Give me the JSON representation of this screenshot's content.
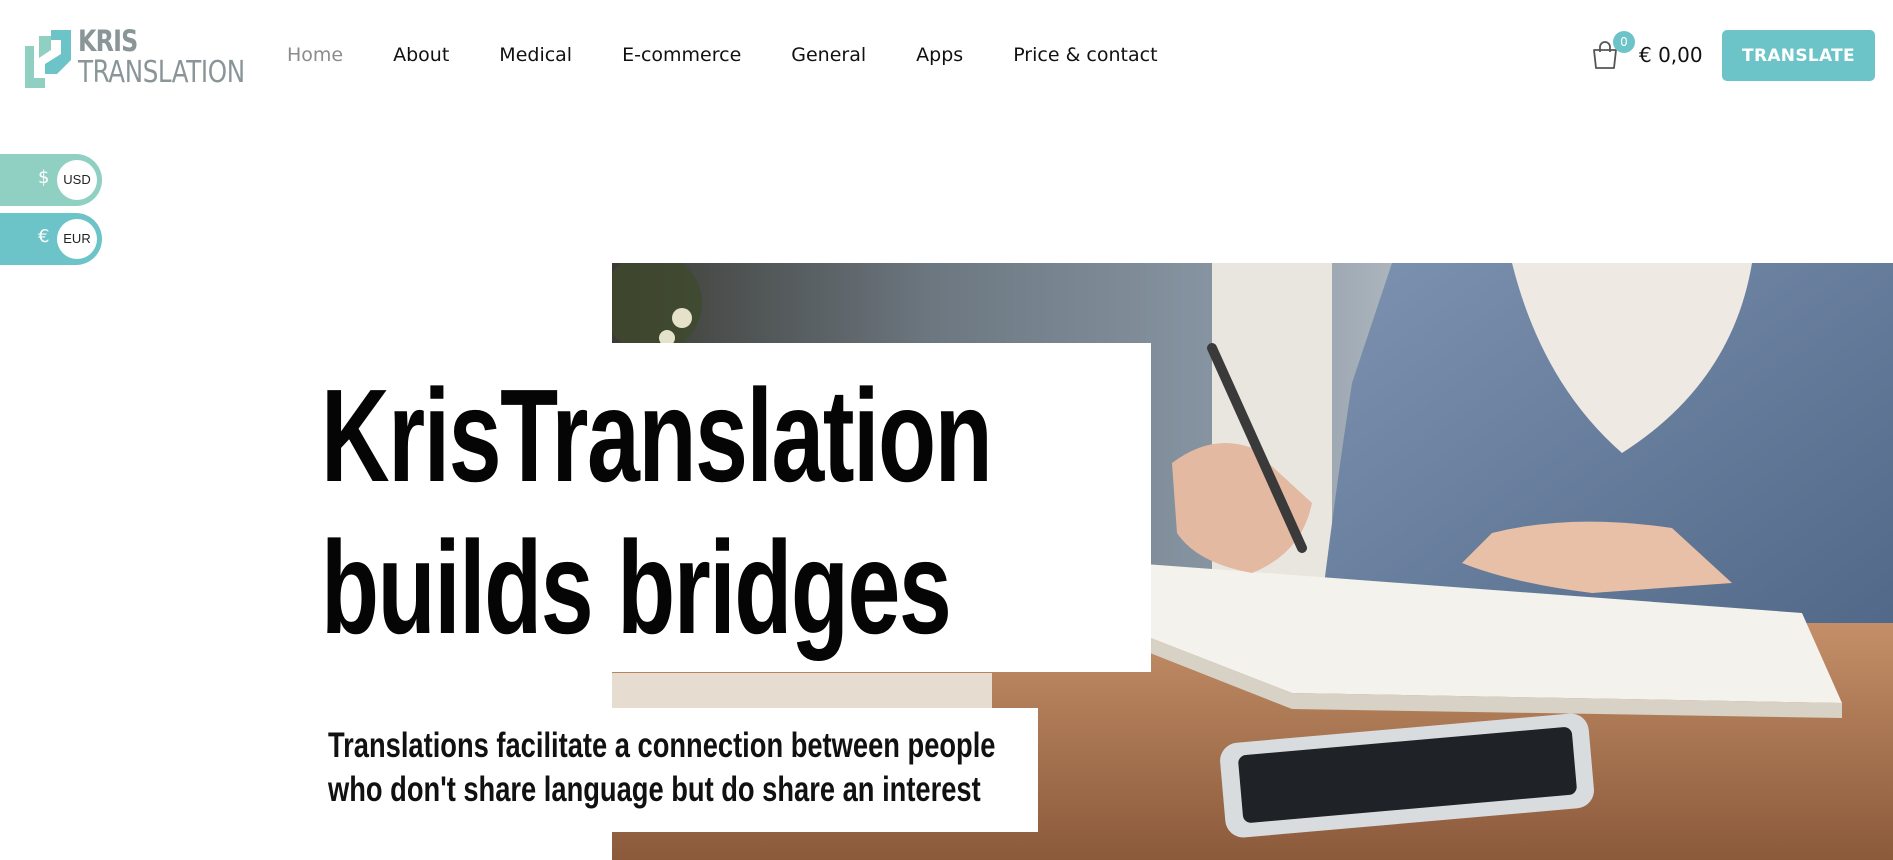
{
  "header": {
    "logo": {
      "line1": "KRIS",
      "line2": "TRANSLATION"
    },
    "nav": [
      {
        "label": "Home",
        "active": true
      },
      {
        "label": "About",
        "active": false
      },
      {
        "label": "Medical",
        "active": false
      },
      {
        "label": "E-commerce",
        "active": false
      },
      {
        "label": "General",
        "active": false
      },
      {
        "label": "Apps",
        "active": false
      },
      {
        "label": "Price & contact",
        "active": false
      }
    ],
    "cart": {
      "icon": "shopping-bag-icon",
      "count": "0",
      "total": "€ 0,00"
    },
    "translate_button": "TRANSLATE"
  },
  "currency_switcher": [
    {
      "symbol": "$",
      "code": "USD",
      "color": "#8fd0c2"
    },
    {
      "symbol": "€",
      "code": "EUR",
      "color": "#6cc4c8"
    }
  ],
  "hero": {
    "headline_line1": "KrisTranslation",
    "headline_line2": "builds bridges",
    "subheading_line1": "Translations facilitate a connection between people",
    "subheading_line2": "who don't share language but do share an interest",
    "image": "person-writing-in-notebook-photo"
  },
  "colors": {
    "accent": "#6cc4c8",
    "logo_mint": "#8fd0c2",
    "logo_text": "#8a9598",
    "text": "#111111"
  }
}
